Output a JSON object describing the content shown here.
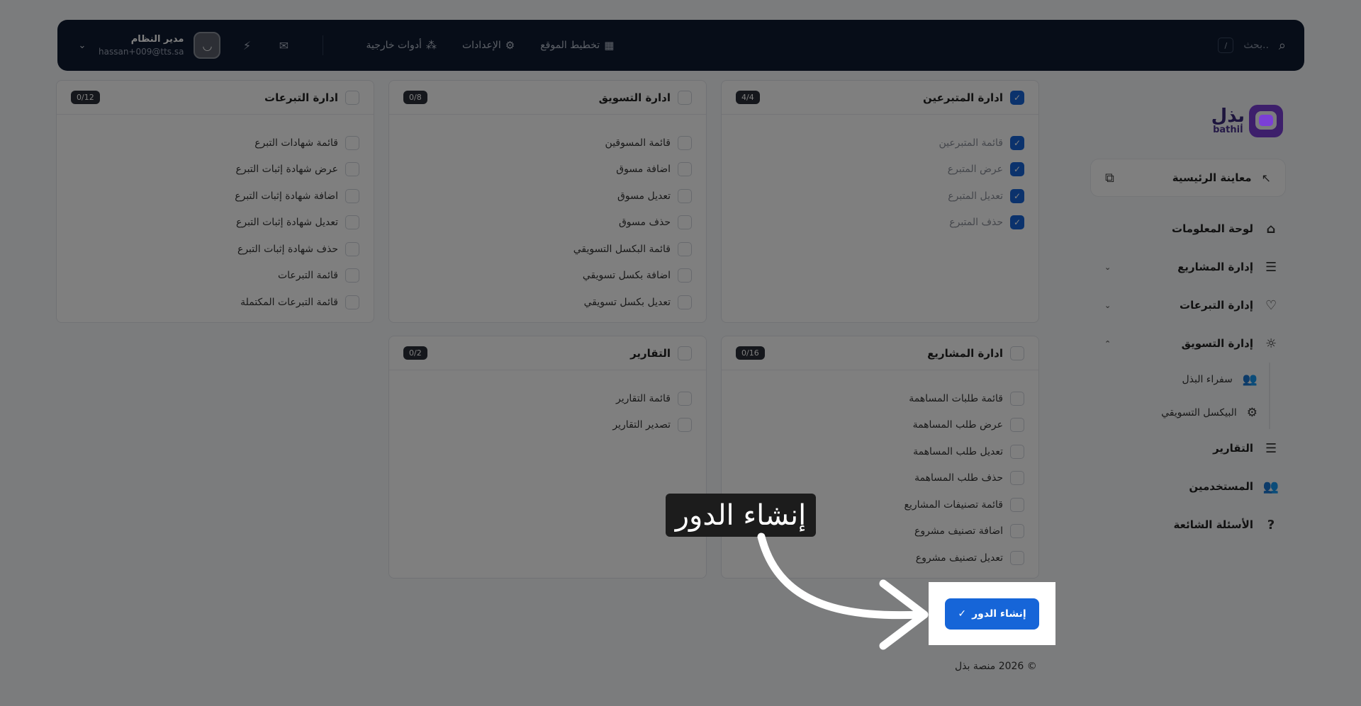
{
  "topbar": {
    "search_placeholder": "بحث..",
    "search_shortcut": "/",
    "links": [
      "تخطيط الموقع",
      "الإعدادات",
      "أدوات خارجية"
    ],
    "user_name": "مدير النظام",
    "user_email": "hassan+009@tts.sa"
  },
  "brand": {
    "ar": "بذل",
    "en": "bathil"
  },
  "sidebar": {
    "preview_label": "معاينة الرئيسية",
    "items": [
      "لوحة المعلومات",
      "إدارة المشاريع",
      "إدارة التبرعات",
      "إدارة التسويق",
      "سفراء البذل",
      "البيكسل التسويقي",
      "التقارير",
      "المستخدمين",
      "الأسئلة الشائعة"
    ]
  },
  "cards": {
    "donors": {
      "title": "ادارة المتبرعين",
      "count": "4/4",
      "items": [
        "قائمة المتبرعين",
        "عرض المتبرع",
        "تعديل المتبرع",
        "حذف المتبرع"
      ]
    },
    "marketing": {
      "title": "ادارة التسويق",
      "count": "0/8",
      "items": [
        "قائمة المسوقين",
        "اضافة مسوق",
        "تعديل مسوق",
        "حذف مسوق",
        "قائمة البكسل التسويقي",
        "اضافة بكسل تسويقي",
        "تعديل بكسل تسويقي"
      ]
    },
    "donations": {
      "title": "ادارة التبرعات",
      "count": "0/12",
      "items": [
        "قائمة شهادات التبرع",
        "عرض شهادة إثبات التبرع",
        "اضافة شهادة إثبات التبرع",
        "تعديل شهادة إثبات التبرع",
        "حذف شهادة إثبات التبرع",
        "قائمة التبرعات",
        "قائمة التبرعات المكتملة"
      ]
    },
    "projects": {
      "title": "ادارة المشاريع",
      "count": "0/16",
      "items": [
        "قائمة طلبات المساهمة",
        "عرض طلب المساهمة",
        "تعديل طلب المساهمة",
        "حذف طلب المساهمة",
        "قائمة تصنيفات المشاريع",
        "اضافة تصنيف مشروع",
        "تعديل تصنيف مشروع"
      ]
    },
    "reports": {
      "title": "التقارير",
      "count": "0/2",
      "items": [
        "قائمة التقارير",
        "تصدير التقارير"
      ]
    }
  },
  "actions": {
    "create_label": "إنشاء الدور"
  },
  "footer": {
    "copyright": "© 2026 منصة بذل"
  },
  "tooltip": {
    "text": "إنشاء الدور"
  }
}
